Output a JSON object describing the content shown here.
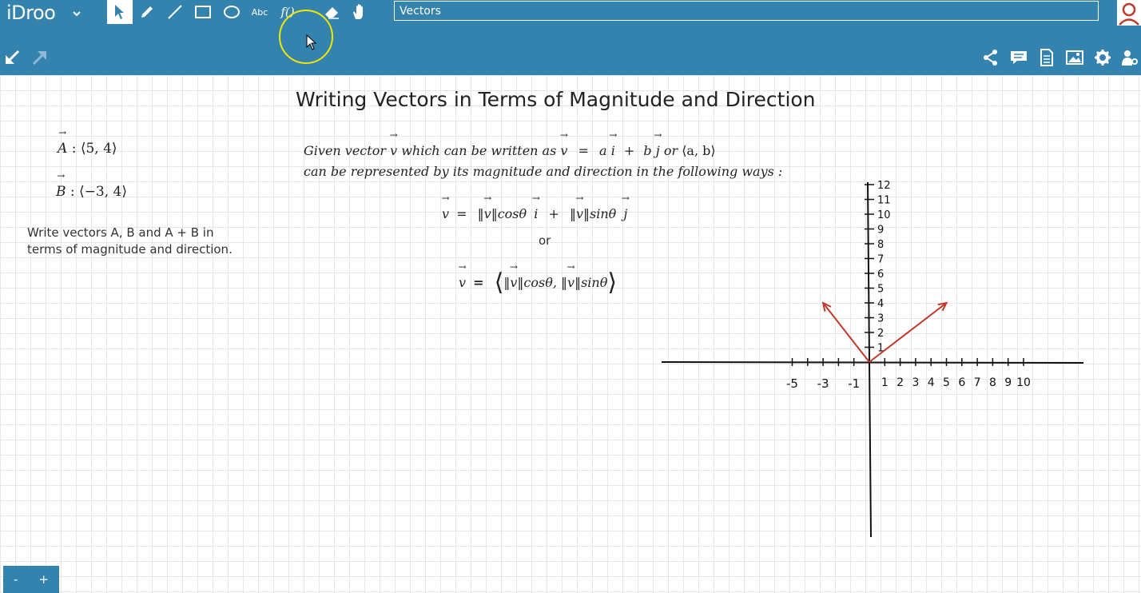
{
  "app": {
    "name": "iDroo"
  },
  "toolbar": {
    "tools": [
      "select",
      "pen",
      "line",
      "rectangle",
      "ellipse",
      "text",
      "formula",
      "eraser",
      "pan"
    ],
    "text_tool_label": "Abc",
    "formula_tool_label": "f()",
    "title_value": "Vectors"
  },
  "zoom": {
    "minus": "-",
    "plus": "+"
  },
  "board": {
    "heading": "Writing Vectors in Terms of Magnitude and Direction",
    "vector_a": {
      "name": "A",
      "value": "⟨5, 4⟩"
    },
    "vector_b": {
      "name": "B",
      "value": "⟨−3, 4⟩"
    },
    "note": "Write vectors A, B and A + B in terms of magnitude and direction.",
    "given_line1": {
      "pre": "Given vector",
      "v": "v",
      "mid": "which can be written as",
      "eq_v": "v",
      "eq": "=",
      "a": "a",
      "i": "i",
      "plus": "+",
      "b": "b",
      "j": "j",
      "or": "or",
      "pair": "⟨a, b⟩"
    },
    "given_line2": "can be represented by its magnitude and direction in the following ways :",
    "formula1": {
      "lhs": "v",
      "eq": "=",
      "norm_open": "‖",
      "v1": "v",
      "norm_close": "‖",
      "cos": "cosθ",
      "i": "i",
      "plus": "+",
      "v2": "v",
      "sin": "sinθ",
      "j": "j"
    },
    "or_label": "or",
    "formula2": {
      "lhs": "v",
      "eq": "=",
      "open": "⟨",
      "v1": "v",
      "cos": "cosθ,",
      "v2": "v",
      "sin": "sinθ",
      "close": "⟩",
      "norm": "‖"
    },
    "graph": {
      "x_neg_labels": [
        "-5",
        "-3",
        "-1"
      ],
      "x_pos_labels": [
        "1",
        "2",
        "3",
        "4",
        "5",
        "6",
        "7",
        "8",
        "9",
        "10"
      ],
      "y_labels": [
        "1",
        "2",
        "3",
        "4",
        "5",
        "6",
        "7",
        "8",
        "9",
        "10",
        "11",
        "12"
      ],
      "arrow_color": "#c0392b",
      "vectors": [
        {
          "x": 5,
          "y": 4
        },
        {
          "x": -3,
          "y": 4
        }
      ]
    }
  }
}
